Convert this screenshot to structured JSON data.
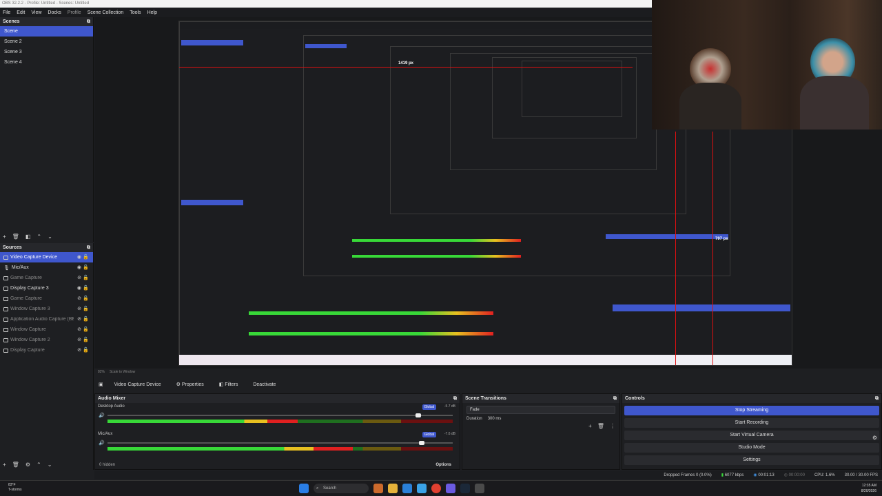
{
  "window": {
    "title": "OBS 32.2.2 - Profile: Untitled - Scenes: Untitled"
  },
  "menu": [
    "File",
    "Edit",
    "View",
    "Docks",
    "Profile",
    "Scene Collection",
    "Tools",
    "Help"
  ],
  "scenes": {
    "title": "Scenes",
    "items": [
      {
        "label": "Scene",
        "selected": true
      },
      {
        "label": "Scene 2",
        "selected": false
      },
      {
        "label": "Scene 3",
        "selected": false
      },
      {
        "label": "Scene 4",
        "selected": false
      }
    ]
  },
  "sources": {
    "title": "Sources",
    "items": [
      {
        "label": "Video Capture Device",
        "selected": true,
        "visible": true
      },
      {
        "label": "Mic/Aux",
        "selected": false,
        "visible": true
      },
      {
        "label": "Game Capture",
        "selected": false,
        "visible": false
      },
      {
        "label": "Display Capture 3",
        "selected": false,
        "visible": true
      },
      {
        "label": "Game Capture",
        "selected": false,
        "visible": false
      },
      {
        "label": "Window Capture 3",
        "selected": false,
        "visible": false
      },
      {
        "label": "Application Audio Capture (BETA)",
        "selected": false,
        "visible": false
      },
      {
        "label": "Window Capture",
        "selected": false,
        "visible": false
      },
      {
        "label": "Window Capture 2",
        "selected": false,
        "visible": false
      },
      {
        "label": "Display Capture",
        "selected": false,
        "visible": false
      }
    ]
  },
  "preview": {
    "px_label_top": "1419 px",
    "px_label_right": "797 px",
    "zoom": "82%",
    "scale_label": "Scale to Window"
  },
  "context_bar": {
    "source_name": "Video Capture Device",
    "properties": "Properties",
    "filters": "Filters",
    "deactivate": "Deactivate"
  },
  "mixer": {
    "title": "Audio Mixer",
    "tracks": [
      {
        "name": "Desktop Audio",
        "db": "-5.7 dB",
        "global": "Global",
        "level": 0.55,
        "volume": 0.9
      },
      {
        "name": "Mic/Aux",
        "db": "-7.6 dB",
        "global": "Global",
        "level": 0.71,
        "volume": 0.91
      }
    ],
    "hidden_label": "0 hidden",
    "options_label": "Options"
  },
  "transitions": {
    "title": "Scene Transitions",
    "selected": "Fade",
    "duration_label": "Duration",
    "duration_value": "300 ms"
  },
  "controls": {
    "title": "Controls",
    "buttons": [
      "Stop Streaming",
      "Start Recording",
      "Start Virtual Camera",
      "Studio Mode",
      "Settings"
    ]
  },
  "status": {
    "dropped": "Dropped Frames 0 (0.0%)",
    "kbps": "6077 kbps",
    "stream_time": "00:01:13",
    "rec_time": "00:00:00",
    "cpu": "CPU: 1.6%",
    "fps": "30.00 / 30.00 FPS"
  },
  "taskbar": {
    "weather_temp": "83°F",
    "weather_desc": "T-storms",
    "search": "Search",
    "time": "12:35 AM",
    "date": "8/20/2026"
  },
  "colors": {
    "accent": "#3f57cd",
    "guide_line": "#e01010",
    "meter_green": "#38d838",
    "meter_yellow": "#e8c020",
    "meter_red": "#e02020"
  }
}
